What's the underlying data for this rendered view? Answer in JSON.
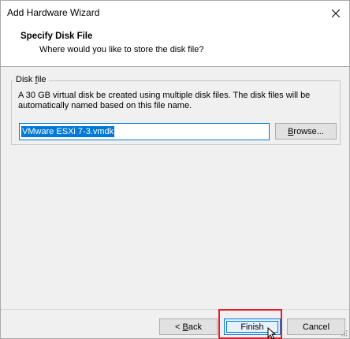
{
  "window": {
    "title": "Add Hardware Wizard"
  },
  "header": {
    "title": "Specify Disk File",
    "subtitle": "Where would you like to store the disk file?"
  },
  "group": {
    "label_prefix": "Disk ",
    "label_accel": "f",
    "label_suffix": "ile",
    "description": "A 30 GB virtual disk be created using multiple disk files. The disk files will be automatically named based on this file name."
  },
  "file_input": {
    "value": "VMware ESXi 7-3.vmdk"
  },
  "buttons": {
    "browse_accel": "B",
    "browse_rest": "rowse...",
    "back_prefix": "< ",
    "back_accel": "B",
    "back_rest": "ack",
    "finish": "Finish",
    "cancel": "Cancel"
  },
  "colors": {
    "accent": "#0078d7",
    "highlight": "#e0202a"
  }
}
